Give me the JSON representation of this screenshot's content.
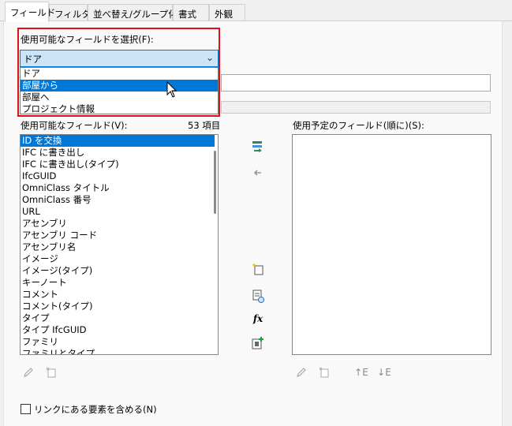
{
  "tabs": [
    "フィールド",
    "フィルタ",
    "並べ替え/グループ化",
    "書式",
    "外観"
  ],
  "category_label": "使用可能なフィールドを選択(F):",
  "category_combo_value": "ドア",
  "category_options": [
    "ドア",
    "部屋から",
    "部屋へ",
    "プロジェクト情報"
  ],
  "category_selected_index": 1,
  "available_label": "使用可能なフィールド(V):",
  "available_count": "53 項目",
  "available_fields": [
    "ID を交換",
    "IFC に書き出し",
    "IFC に書き出し(タイプ)",
    "IfcGUID",
    "OmniClass タイトル",
    "OmniClass 番号",
    "URL",
    "アセンブリ",
    "アセンブリ コード",
    "アセンブリ名",
    "イメージ",
    "イメージ(タイプ)",
    "キーノート",
    "コメント",
    "コメント(タイプ)",
    "タイプ",
    "タイプ IfcGUID",
    "ファミリ",
    "ファミリとタイプ"
  ],
  "scheduled_label": "使用予定のフィールド(順に)(S):",
  "scheduled_fields": [],
  "include_linked_label": "リンクにある要素を含める(N)",
  "include_linked_checked": false,
  "icons": {
    "add": "add-parameter-icon",
    "remove": "remove-parameter-icon",
    "new_param": "new-parameter-icon",
    "combine": "combine-parameters-icon",
    "calc": "calculated-value-icon",
    "add_all": "add-all-icon"
  }
}
